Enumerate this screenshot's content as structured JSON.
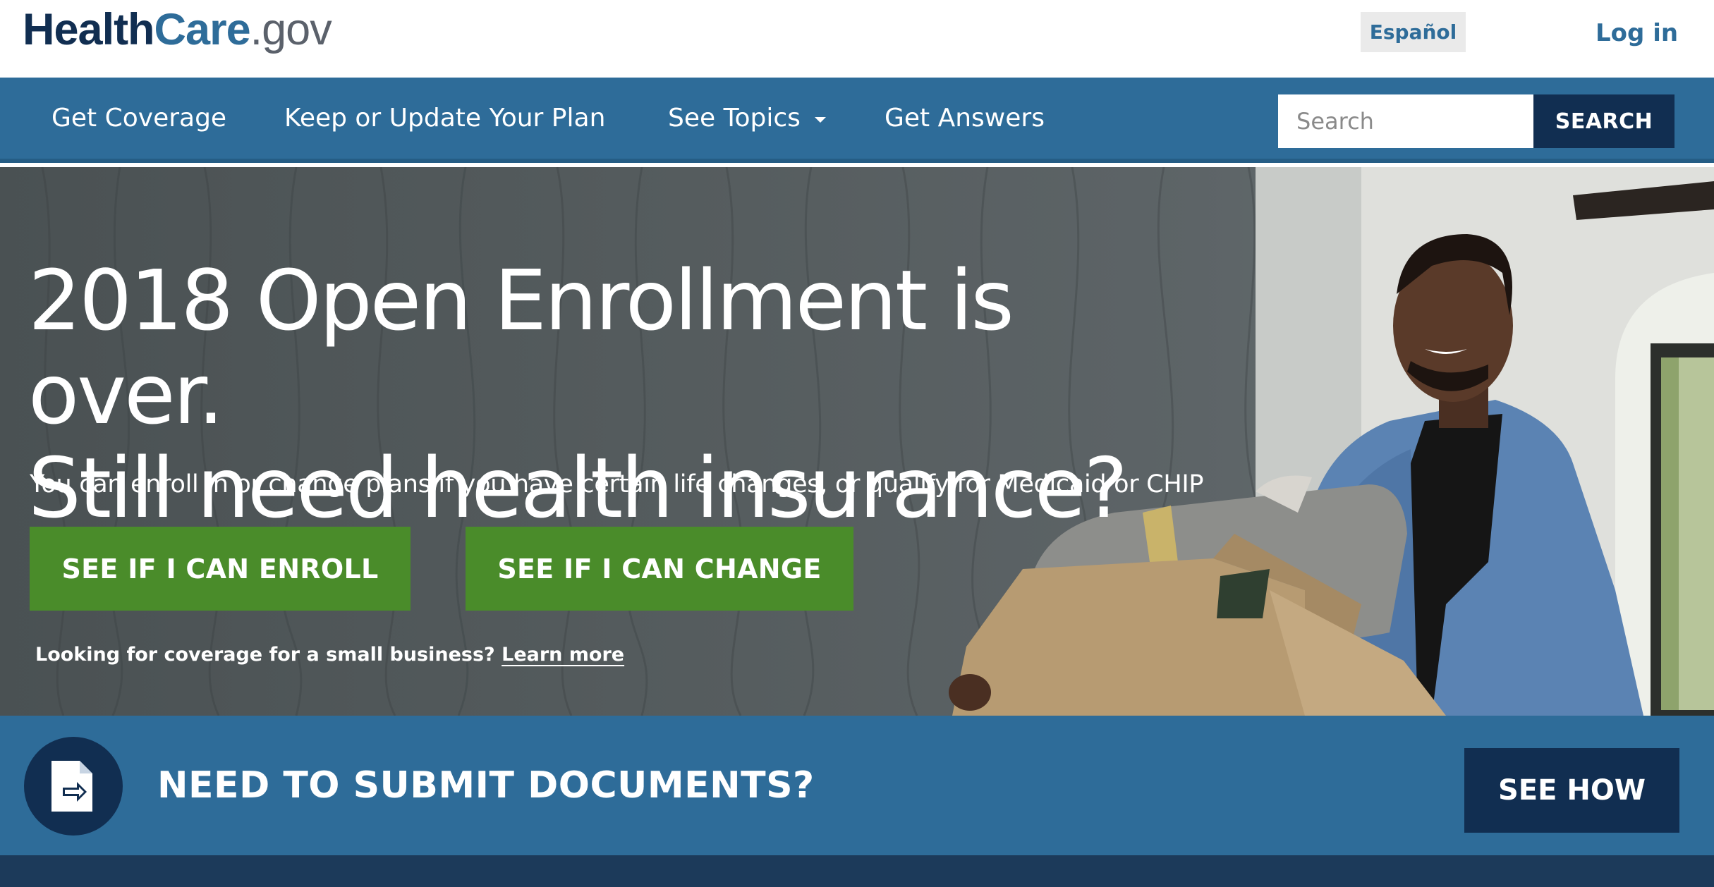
{
  "header": {
    "logo": {
      "part1": "Health",
      "part2": "Care",
      "part3": ".gov"
    },
    "language_label": "Español",
    "login_label": "Log in"
  },
  "nav": {
    "items": [
      {
        "label": "Get Coverage"
      },
      {
        "label": "Keep or Update Your Plan"
      },
      {
        "label": "See Topics",
        "has_dropdown": true
      },
      {
        "label": "Get Answers"
      }
    ],
    "search": {
      "placeholder": "Search",
      "value": "",
      "button_label": "SEARCH"
    }
  },
  "hero": {
    "title_line1": "2018 Open Enrollment is over.",
    "title_line2": "Still need health insurance?",
    "subtitle": "You can enroll in or change plans if you have certain life changes, or qualify for Medicaid or CHIP",
    "cta_enroll": "SEE IF I CAN ENROLL",
    "cta_change": "SEE IF I CAN CHANGE",
    "smallbiz_text": "Looking for coverage for a small business?",
    "smallbiz_link": "Learn more"
  },
  "documents": {
    "icon": "document-arrow-icon",
    "title": "NEED TO SUBMIT DOCUMENTS?",
    "button_label": "SEE HOW"
  },
  "colors": {
    "brand_navy": "#112e51",
    "brand_blue": "#2e6c99",
    "cta_green": "#4a8c2a",
    "header_bg": "#ffffff"
  }
}
